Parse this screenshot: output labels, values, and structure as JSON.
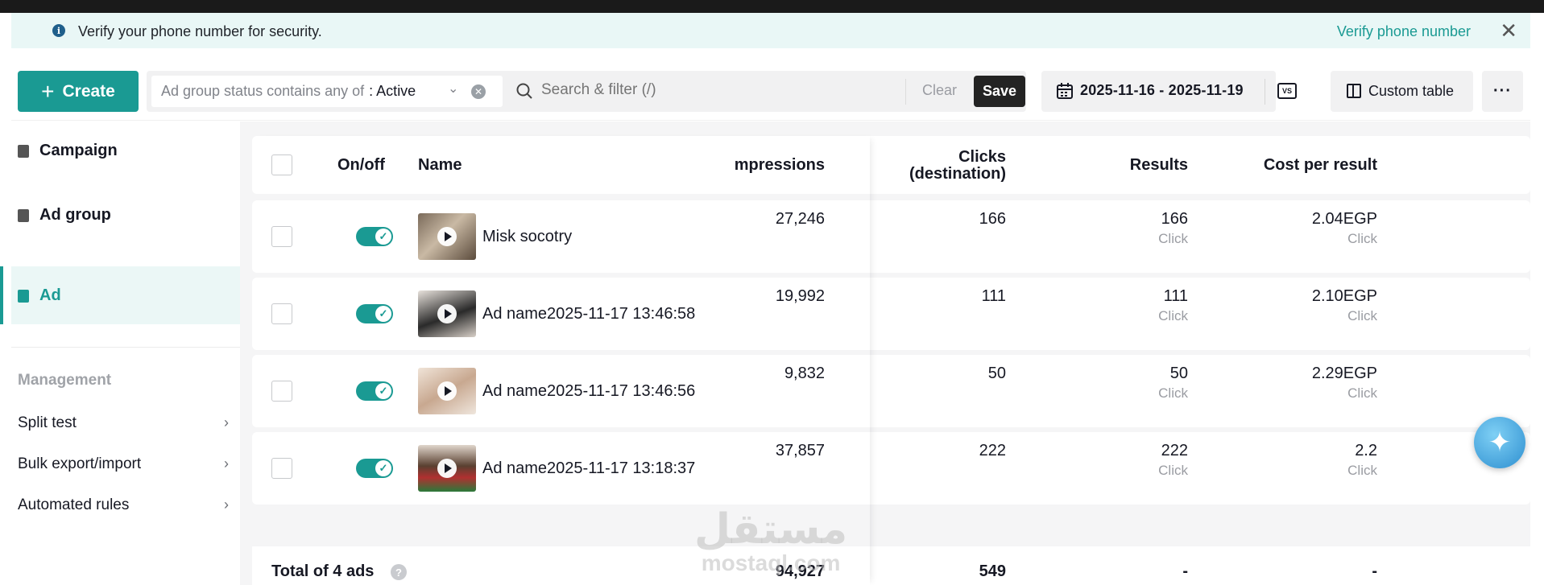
{
  "banner": {
    "message": "Verify your phone number for security.",
    "link": "Verify phone number",
    "close_icon": "close-icon",
    "info_icon": "info-icon"
  },
  "toolbar": {
    "create_label": "Create",
    "filter_chip_prefix": "Ad group status contains any of",
    "filter_chip_value": ": Active",
    "search_placeholder": "Search & filter (/)",
    "clear_label": "Clear",
    "save_label": "Save",
    "date_range": "2025-11-16 - 2025-11-19",
    "vs_label": "VS",
    "custom_table_label": "Custom table",
    "more_label": "···"
  },
  "sidebar": {
    "nav": [
      {
        "label": "Campaign",
        "icon": "folder-icon"
      },
      {
        "label": "Ad group",
        "icon": "ad-group-icon"
      },
      {
        "label": "Ad",
        "icon": "ad-icon"
      }
    ],
    "management_heading": "Management",
    "management_items": [
      {
        "label": "Split test"
      },
      {
        "label": "Bulk export/import"
      },
      {
        "label": "Automated rules"
      }
    ]
  },
  "table": {
    "headers": {
      "onoff": "On/off",
      "name": "Name",
      "impressions": "mpressions",
      "clicks_line1": "Clicks",
      "clicks_line2": "(destination)",
      "results": "Results",
      "cost": "Cost per result"
    },
    "rows": [
      {
        "name": "Misk socotry",
        "impressions": "27,246",
        "clicks": "166",
        "results": "166",
        "results_sub": "Click",
        "cost": "2.04EGP",
        "cost_sub": "Click",
        "enabled": true
      },
      {
        "name": "Ad name2025-11-17 13:46:58",
        "impressions": "19,992",
        "clicks": "111",
        "results": "111",
        "results_sub": "Click",
        "cost": "2.10EGP",
        "cost_sub": "Click",
        "enabled": true
      },
      {
        "name": "Ad name2025-11-17 13:46:56",
        "impressions": "9,832",
        "clicks": "50",
        "results": "50",
        "results_sub": "Click",
        "cost": "2.29EGP",
        "cost_sub": "Click",
        "enabled": true
      },
      {
        "name": "Ad name2025-11-17 13:18:37",
        "impressions": "37,857",
        "clicks": "222",
        "results": "222",
        "results_sub": "Click",
        "cost": "2.2",
        "cost_sub": "Click",
        "enabled": true
      }
    ],
    "total": {
      "label": "Total of 4 ads",
      "impressions": "94,927",
      "clicks": "549",
      "results": "-",
      "cost": "-"
    }
  },
  "watermark": {
    "arabic": "مستقل",
    "latin": "mostaql.com"
  }
}
